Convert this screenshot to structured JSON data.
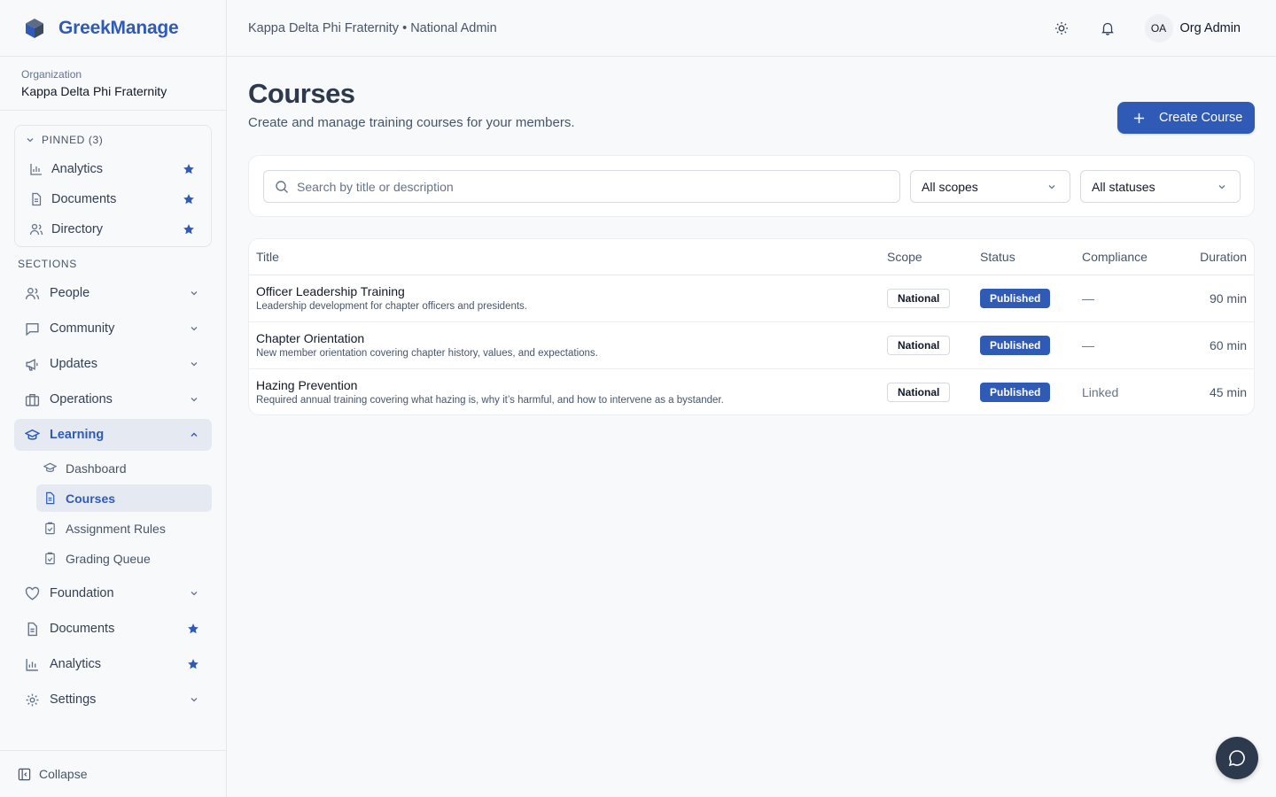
{
  "brand": {
    "name": "GreekManage"
  },
  "org": {
    "label": "Organization",
    "name": "Kappa Delta Phi Fraternity"
  },
  "pinned": {
    "header": "PINNED (3)",
    "items": [
      {
        "label": "Analytics",
        "icon": "bar-chart-icon"
      },
      {
        "label": "Documents",
        "icon": "document-icon"
      },
      {
        "label": "Directory",
        "icon": "users-icon"
      }
    ]
  },
  "sections_label": "SECTIONS",
  "nav": {
    "people": "People",
    "community": "Community",
    "updates": "Updates",
    "operations": "Operations",
    "learning": "Learning",
    "learning_sub": [
      "Dashboard",
      "Courses",
      "Assignment Rules",
      "Grading Queue"
    ],
    "foundation": "Foundation",
    "documents": "Documents",
    "analytics": "Analytics",
    "settings": "Settings"
  },
  "collapse_label": "Collapse",
  "topbar": {
    "breadcrumb": "Kappa Delta Phi Fraternity • National Admin",
    "avatar_initials": "OA",
    "user_name": "Org Admin"
  },
  "page": {
    "title": "Courses",
    "subtitle": "Create and manage training courses for your members.",
    "create_label": "Create Course"
  },
  "filters": {
    "search_placeholder": "Search by title or description",
    "scope_value": "All scopes",
    "status_value": "All statuses"
  },
  "table": {
    "headers": {
      "title": "Title",
      "scope": "Scope",
      "status": "Status",
      "compliance": "Compliance",
      "duration": "Duration"
    },
    "rows": [
      {
        "title": "Officer Leadership Training",
        "desc": "Leadership development for chapter officers and presidents.",
        "scope": "National",
        "status": "Published",
        "compliance": "—",
        "duration": "90 min"
      },
      {
        "title": "Chapter Orientation",
        "desc": "New member orientation covering chapter history, values, and expectations.",
        "scope": "National",
        "status": "Published",
        "compliance": "—",
        "duration": "60 min"
      },
      {
        "title": "Hazing Prevention",
        "desc": "Required annual training covering what hazing is, why it’s harmful, and how to intervene as a bystander.",
        "scope": "National",
        "status": "Published",
        "compliance": "Linked",
        "duration": "45 min"
      }
    ]
  },
  "colors": {
    "accent": "#2f5bb7",
    "dark": "#2d3a4d"
  }
}
